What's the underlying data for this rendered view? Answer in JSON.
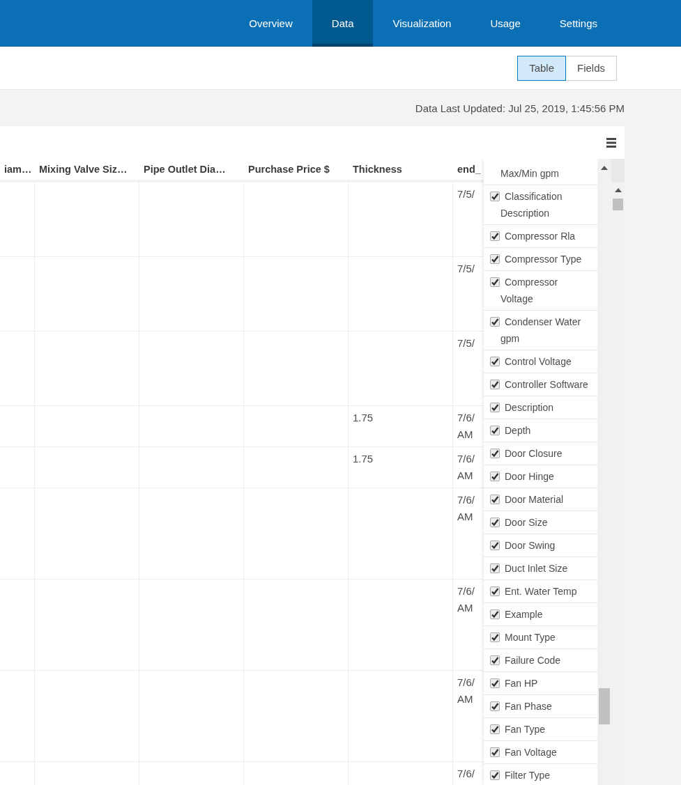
{
  "nav": {
    "tabs": [
      {
        "label": "Overview",
        "selected": false
      },
      {
        "label": "Data",
        "selected": true
      },
      {
        "label": "Visualization",
        "selected": false
      },
      {
        "label": "Usage",
        "selected": false
      },
      {
        "label": "Settings",
        "selected": false
      }
    ]
  },
  "view_toggle": [
    {
      "label": "Table",
      "selected": true
    },
    {
      "label": "Fields",
      "selected": false
    }
  ],
  "last_updated": "Data Last Updated: Jul 25, 2019, 1:45:56 PM",
  "table": {
    "columns": [
      "iam…",
      "Mixing Valve Siz…",
      "Pipe Outlet Dia…",
      "Purchase Price $",
      "Thickness",
      "end_"
    ],
    "rows": [
      [
        "",
        "",
        "",
        "",
        "",
        "7/5/"
      ],
      [
        "",
        "",
        "",
        "",
        "",
        "7/5/"
      ],
      [
        "",
        "",
        "",
        "",
        "",
        "7/5/"
      ],
      [
        "",
        "",
        "",
        "",
        "1.75",
        "7/6/ AM"
      ],
      [
        "",
        "",
        "",
        "",
        "1.75",
        "7/6/ AM"
      ],
      [
        "",
        "",
        "",
        "",
        "",
        "7/6/ AM"
      ],
      [
        "",
        "",
        "",
        "",
        "",
        "7/6/ AM"
      ],
      [
        "",
        "",
        "",
        "",
        "",
        "7/6/ AM"
      ],
      [
        "",
        "",
        "",
        "",
        "",
        "7/6/"
      ]
    ]
  },
  "field_list": {
    "items": [
      {
        "kind": "continuation",
        "label": "Max/Min gpm"
      },
      {
        "kind": "checkbox",
        "label": "Classification Description",
        "checked": true
      },
      {
        "kind": "checkbox",
        "label": "Compressor Rla",
        "checked": true
      },
      {
        "kind": "checkbox",
        "label": "Compressor Type",
        "checked": true
      },
      {
        "kind": "checkbox",
        "label": "Compressor Voltage",
        "checked": true
      },
      {
        "kind": "checkbox",
        "label": "Condenser Water gpm",
        "checked": true
      },
      {
        "kind": "checkbox",
        "label": "Control Voltage",
        "checked": true
      },
      {
        "kind": "checkbox",
        "label": "Controller Software",
        "checked": true
      },
      {
        "kind": "checkbox",
        "label": "Description",
        "checked": true
      },
      {
        "kind": "checkbox",
        "label": "Depth",
        "checked": true
      },
      {
        "kind": "checkbox",
        "label": "Door Closure",
        "checked": true
      },
      {
        "kind": "checkbox",
        "label": "Door Hinge",
        "checked": true
      },
      {
        "kind": "checkbox",
        "label": "Door Material",
        "checked": true
      },
      {
        "kind": "checkbox",
        "label": "Door Size",
        "checked": true
      },
      {
        "kind": "checkbox",
        "label": "Door Swing",
        "checked": true
      },
      {
        "kind": "checkbox",
        "label": "Duct Inlet Size",
        "checked": true
      },
      {
        "kind": "checkbox",
        "label": "Ent. Water Temp",
        "checked": true
      },
      {
        "kind": "checkbox",
        "label": "Example",
        "checked": true
      },
      {
        "kind": "checkbox",
        "label": "Mount Type",
        "checked": true
      },
      {
        "kind": "checkbox",
        "label": "Failure Code",
        "checked": true
      },
      {
        "kind": "checkbox",
        "label": "Fan HP",
        "checked": true
      },
      {
        "kind": "checkbox",
        "label": "Fan Phase",
        "checked": true
      },
      {
        "kind": "checkbox",
        "label": "Fan Type",
        "checked": true
      },
      {
        "kind": "checkbox",
        "label": "Fan Voltage",
        "checked": true
      },
      {
        "kind": "checkbox",
        "label": "Filter Type",
        "checked": true
      }
    ]
  }
}
